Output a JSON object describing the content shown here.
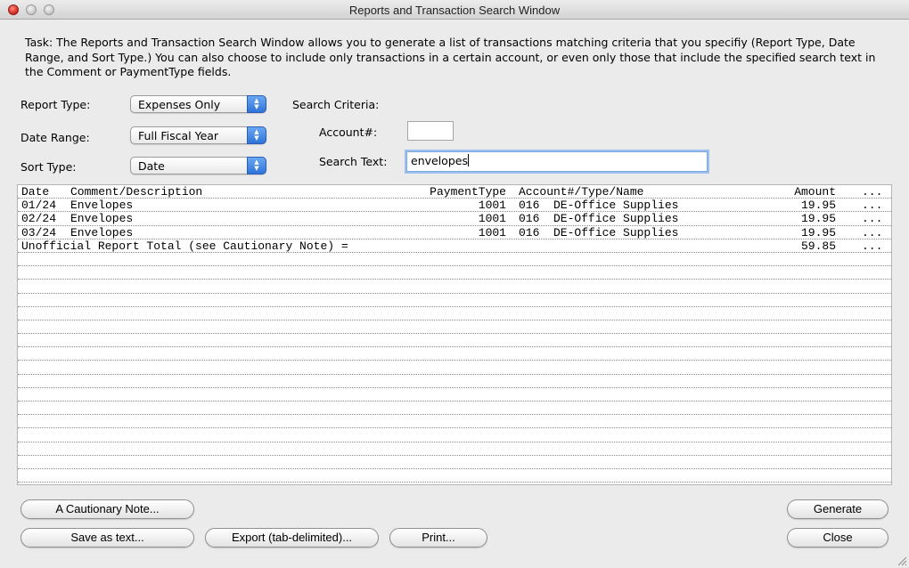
{
  "window": {
    "title": "Reports and Transaction Search Window",
    "title_color": "#222222"
  },
  "task_text": "Task: The Reports and Transaction Search Window allows you to generate a list of transactions matching criteria that you specifiy (Report Type, Date Range, and Sort Type.) You can also choose to include only transactions in a certain account, or even only those that include the specified search text in the Comment or PaymentType fields.",
  "form": {
    "report_type": {
      "label": "Report Type:",
      "value": "Expenses Only"
    },
    "date_range": {
      "label": "Date Range:",
      "value": "Full Fiscal Year"
    },
    "sort_type": {
      "label": "Sort Type:",
      "value": "Date"
    },
    "search_criteria_label": "Search Criteria:",
    "account": {
      "label": "Account#:",
      "value": ""
    },
    "search_text": {
      "label": "Search Text:",
      "value": "envelopes"
    }
  },
  "report": {
    "columns": {
      "date": "Date",
      "description": "Comment/Description",
      "payment_type": "PaymentType",
      "account": "Account#/Type/Name",
      "amount": "Amount",
      "more": "..."
    },
    "rows": [
      {
        "date": "01/24",
        "description": "Envelopes",
        "payment_type": "1001",
        "account": "016  DE-Office Supplies",
        "amount": "19.95",
        "more": "..."
      },
      {
        "date": "02/24",
        "description": "Envelopes",
        "payment_type": "1001",
        "account": "016  DE-Office Supplies",
        "amount": "19.95",
        "more": "..."
      },
      {
        "date": "03/24",
        "description": "Envelopes",
        "payment_type": "1001",
        "account": "016  DE-Office Supplies",
        "amount": "19.95",
        "more": "..."
      }
    ],
    "total": {
      "label": "Unofficial Report Total (see Cautionary Note) =",
      "amount": "59.85",
      "more": "..."
    }
  },
  "buttons": {
    "cautionary_note": "A Cautionary Note...",
    "save_as_text": "Save as text...",
    "export": "Export (tab-delimited)...",
    "print": "Print...",
    "generate": "Generate",
    "close": "Close"
  },
  "colors": {
    "window_bg": "#ebebeb",
    "popup_accent": "#2f73d9",
    "focus_ring": "#9cc1f0"
  }
}
